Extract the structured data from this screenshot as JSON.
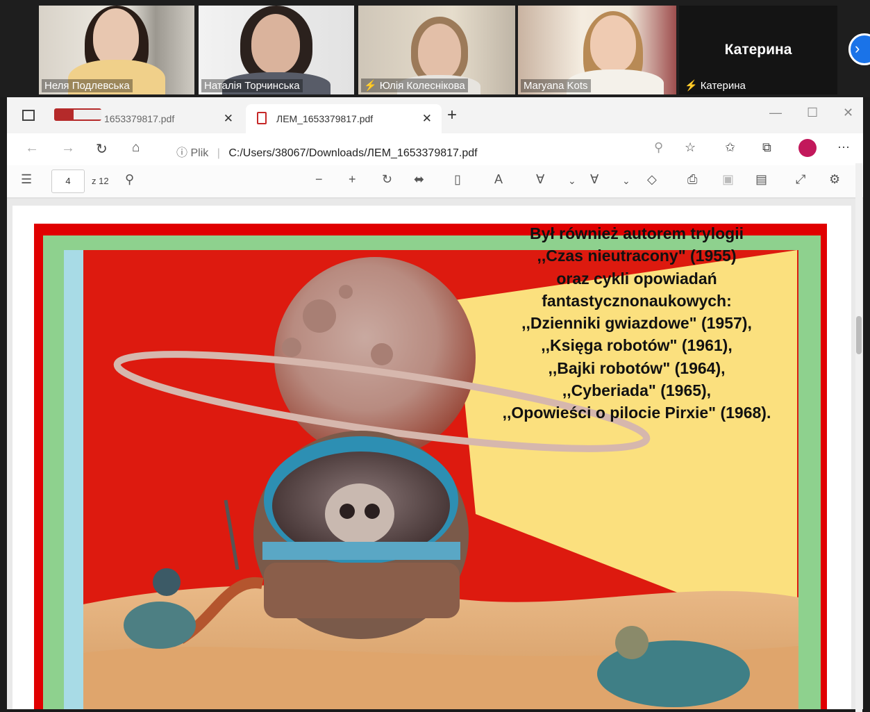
{
  "participants": [
    {
      "name": "Неля Подлевська",
      "muted": false
    },
    {
      "name": "Наталія Торчинська",
      "muted": false
    },
    {
      "name": "Юлія Колеснікова",
      "muted": true
    },
    {
      "name": "Maryana Kots",
      "muted": false
    },
    {
      "name": "Катерина",
      "muted": true,
      "camera_off": true
    }
  ],
  "big_name": "Катерина",
  "browser": {
    "tabs": [
      {
        "title": "1653379817.pdf",
        "active": false
      },
      {
        "title": "ЛЕМ_1653379817.pdf",
        "active": true
      }
    ],
    "address": {
      "info_label": "Plik",
      "url": "C:/Users/38067/Downloads/ЛЕМ_1653379817.pdf"
    }
  },
  "pdf_toolbar": {
    "page_number": "4",
    "page_of": "z 12"
  },
  "slide": {
    "lines": [
      "Był również autorem trylogii",
      ",,Czas nieutracony\" (1955)",
      "oraz cykli opowiadań",
      "fantastycznonaukowych:",
      ",,Dzienniki gwiazdowe\" (1957),",
      ",,Księga robotów\" (1961),",
      ",,Bajki robotów\" (1964),",
      ",,Cyberiada\" (1965),",
      ",,Opowieści o pilocie Pirxie\" (1968)."
    ]
  },
  "colors": {
    "slide_border": "#e00000",
    "slide_green": "#8ed18e",
    "slide_blue": "#a8dbe6",
    "quote_bg": "#fbe07e",
    "accent": "#1a73e8"
  }
}
